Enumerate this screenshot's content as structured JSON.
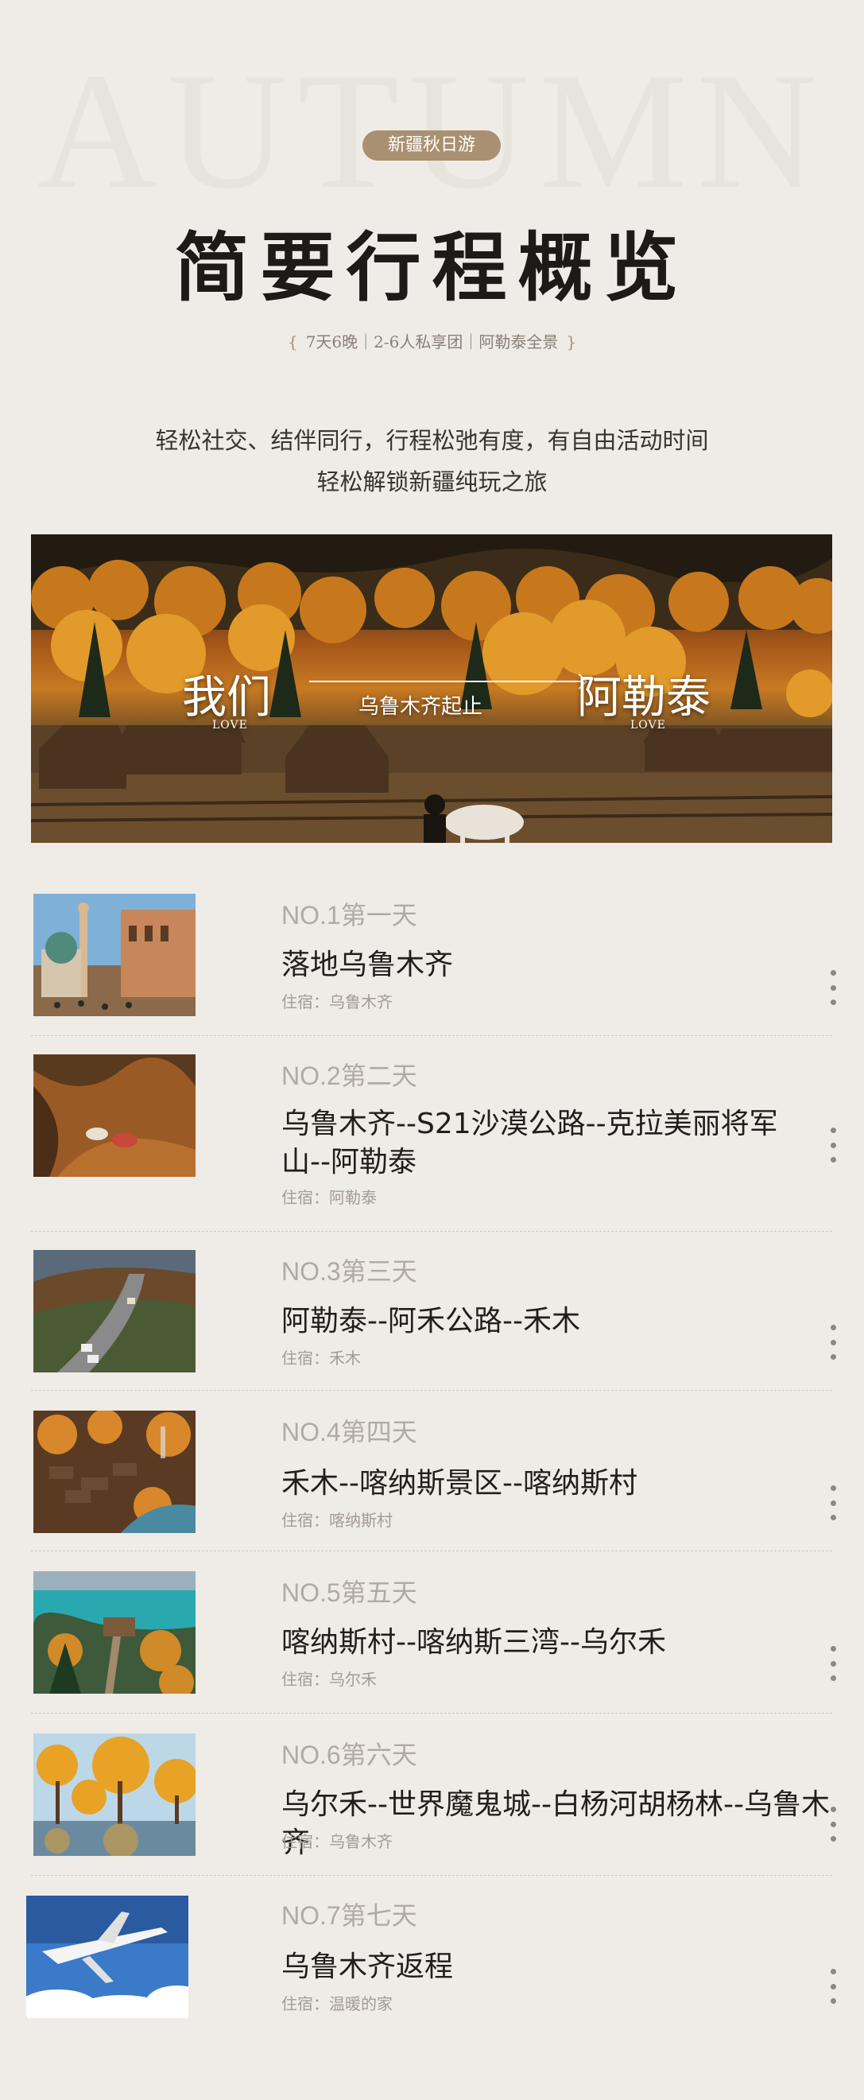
{
  "background_word": "AUTUMN",
  "badge": "新疆秋日游",
  "title": "简要行程概览",
  "subtitle": {
    "open": "{",
    "text": "7天6晚｜2-6人私享团｜阿勒泰全景",
    "close": "}"
  },
  "intro": {
    "line1": "轻松社交、结伴同行，行程松弛有度，有自由活动时间",
    "line2": "轻松解锁新疆纯玩之旅"
  },
  "hero": {
    "left_word": "我们",
    "left_love": "LOVE",
    "middle": "乌鲁木齐起止",
    "right_word": "阿勒泰",
    "right_love": "LOVE"
  },
  "days": [
    {
      "no": "NO.1第一天",
      "route": "落地乌鲁木齐",
      "stay": "住宿：乌鲁木齐",
      "image": "city-mosque-photo"
    },
    {
      "no": "NO.2第二天",
      "route": "乌鲁木齐--S21沙漠公路--克拉美丽将军山--阿勒泰",
      "stay": "住宿：阿勒泰",
      "image": "desert-aerial-photo"
    },
    {
      "no": "NO.3第三天",
      "route": "阿勒泰--阿禾公路--禾木",
      "stay": "住宿：禾木",
      "image": "mountain-road-photo"
    },
    {
      "no": "NO.4第四天",
      "route": "禾木--喀纳斯景区--喀纳斯村",
      "stay": "住宿：喀纳斯村",
      "image": "autumn-village-photo"
    },
    {
      "no": "NO.5第五天",
      "route": "喀纳斯村--喀纳斯三湾--乌尔禾",
      "stay": "住宿：乌尔禾",
      "image": "turquoise-lake-photo"
    },
    {
      "no": "NO.6第六天",
      "route": "乌尔禾--世界魔鬼城--白杨河胡杨林--乌鲁木齐",
      "stay": "住宿：乌鲁木齐",
      "image": "golden-poplar-photo"
    },
    {
      "no": "NO.7第七天",
      "route": "乌鲁木齐返程",
      "stay": "住宿：温暖的家",
      "image": "airplane-photo"
    }
  ]
}
